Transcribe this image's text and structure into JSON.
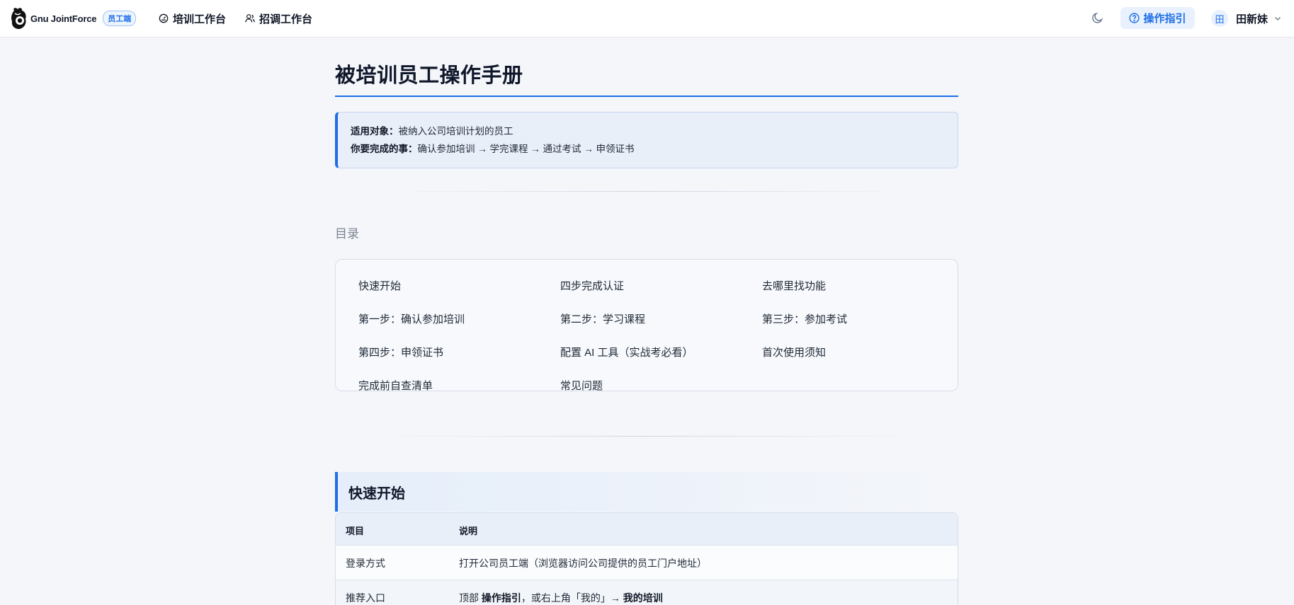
{
  "header": {
    "brand_name": "Gnu JointForce",
    "role_badge": "员工端",
    "nav": [
      {
        "label": "培训工作台",
        "icon": "dashboard-icon"
      },
      {
        "label": "招调工作台",
        "icon": "users-icon"
      }
    ],
    "theme_icon": "moon-icon",
    "guide_label": "操作指引",
    "guide_icon": "help-circle-icon",
    "avatar_initial": "田",
    "user_name": "田新妹",
    "user_menu_icon": "chevron-down-icon"
  },
  "page": {
    "title": "被培训员工操作手册",
    "callout": {
      "audience_label": "适用对象",
      "audience_value": "被纳入公司培训计划的员工",
      "tasks_label": "你要完成的事",
      "tasks_value": "确认参加培训 → 学完课程 → 通过考试 → 申领证书"
    },
    "toc_heading": "目录",
    "toc": [
      [
        "快速开始",
        "四步完成认证",
        "去哪里找功能"
      ],
      [
        "第一步：确认参加培训",
        "第二步：学习课程",
        "第三步：参加考试"
      ],
      [
        "第四步：申领证书",
        "配置 AI 工具（实战考必看）",
        "首次使用须知"
      ],
      [
        "完成前自查清单",
        "常见问题"
      ]
    ],
    "section_title": "快速开始",
    "table": {
      "headers": [
        "项目",
        "说明"
      ],
      "rows": [
        {
          "item": "登录方式",
          "desc": "打开公司员工端（浏览器访问公司提供的员工门户地址）"
        },
        {
          "item": "推荐入口",
          "desc_pre": "顶部 ",
          "desc_b1": "操作指引",
          "desc_mid": "，或右上角「我的」→ ",
          "desc_b2": "我的培训"
        }
      ]
    }
  },
  "colors": {
    "accent": "#1d6ee8",
    "background": "#f4f6fa",
    "callout_bg": "#e9eff9"
  }
}
